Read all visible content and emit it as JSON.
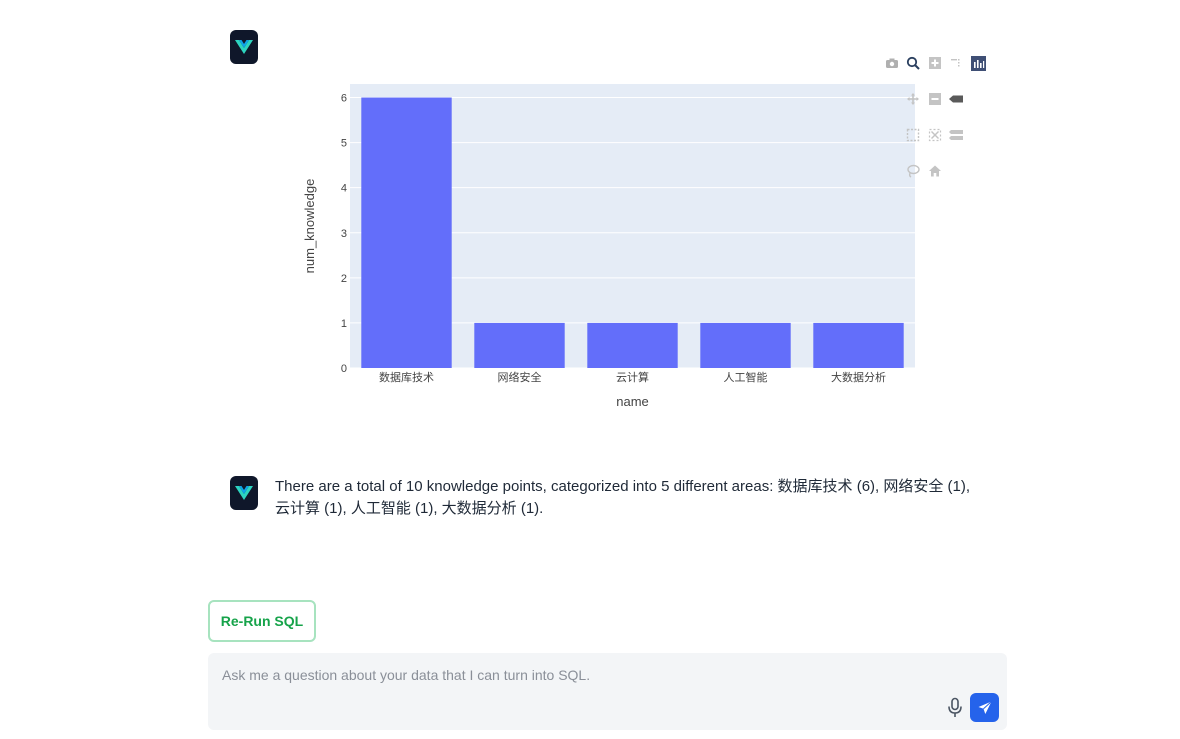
{
  "chart_data": {
    "type": "bar",
    "categories": [
      "数据库技术",
      "网络安全",
      "云计算",
      "人工智能",
      "大数据分析"
    ],
    "values": [
      6,
      1,
      1,
      1,
      1
    ],
    "xlabel": "name",
    "ylabel": "num_knowledge",
    "ylim": [
      0,
      6.3
    ],
    "yticks": [
      0,
      1,
      2,
      3,
      4,
      5,
      6
    ],
    "grid": true,
    "bar_color": "#636efa",
    "plot_bg": "#e5ecf6"
  },
  "assistant_message": {
    "text": "There are a total of 10 knowledge points, categorized into 5 different areas: 数据库技术 (6), 网络安全 (1), 云计算 (1), 人工智能 (1), 大数据分析 (1)."
  },
  "actions": {
    "rerun_label": "Re-Run SQL"
  },
  "chat_input": {
    "placeholder": "Ask me a question about your data that I can turn into SQL.",
    "value": ""
  },
  "colors": {
    "accent": "#2563eb",
    "success": "#16a34a",
    "avatar_bg": "#0f172a",
    "logo_teal": "#2dd4bf"
  }
}
